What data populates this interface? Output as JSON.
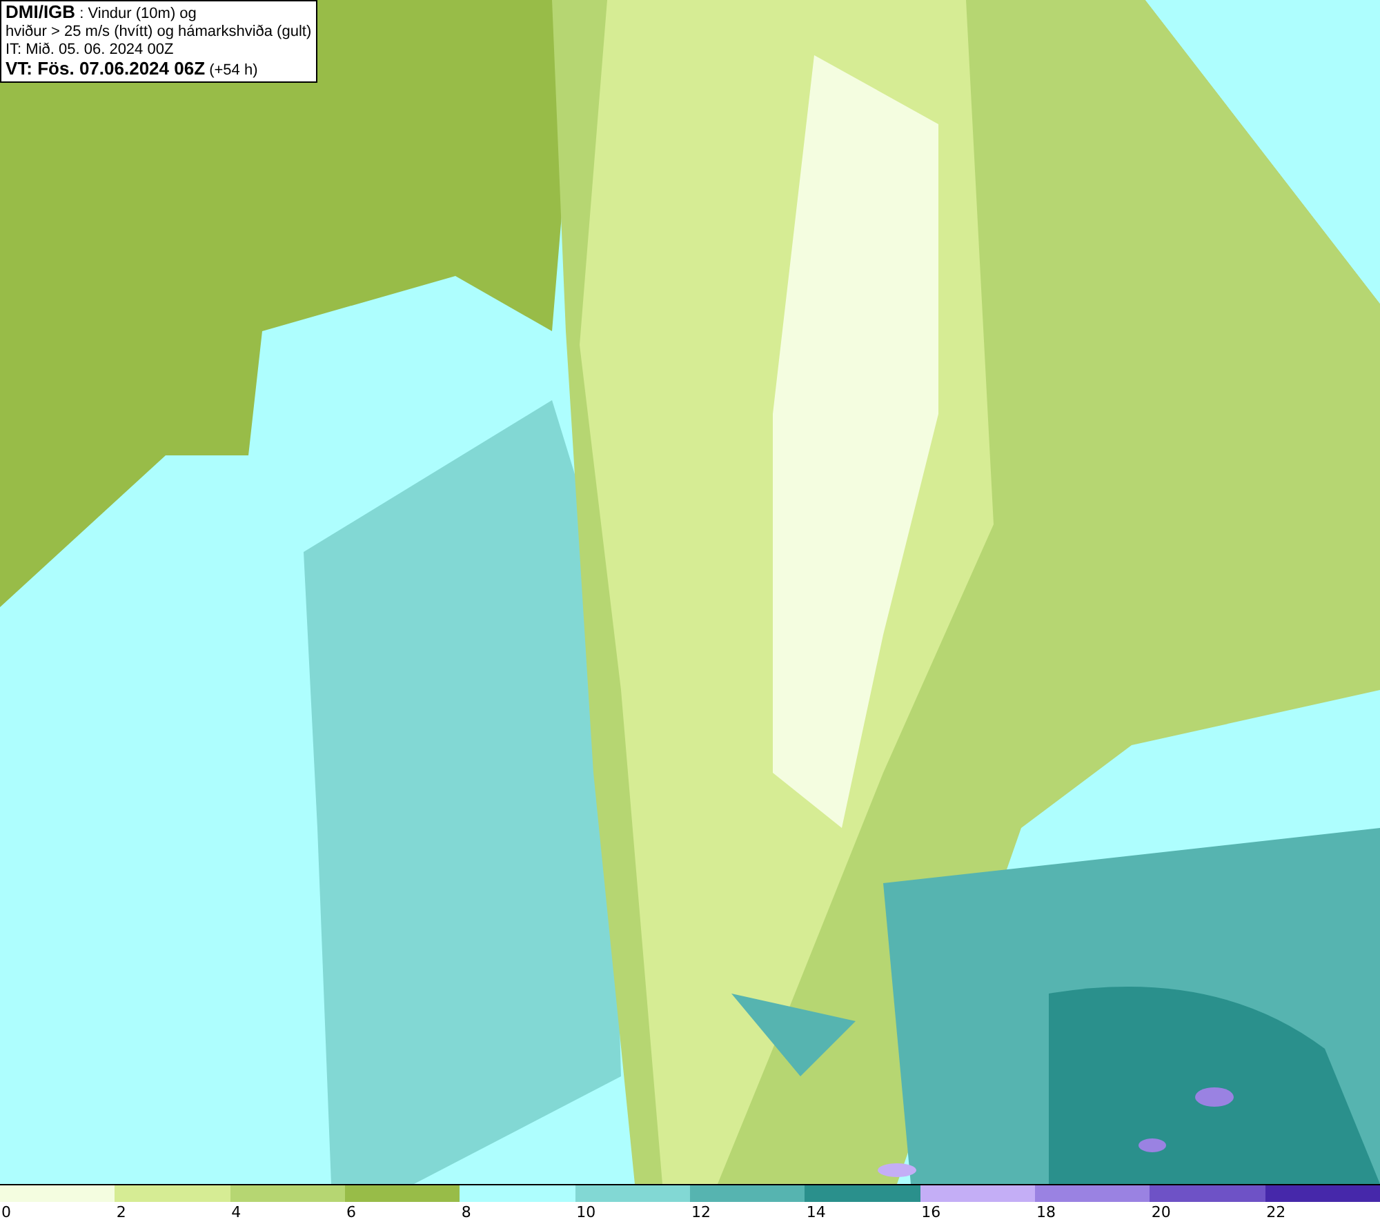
{
  "header": [
    "**DMI/IGB** : Vindur (10m) og",
    "hviður > 25 m/s (hvítt) og hámarkshviða (gult)",
    "IT: Mið. 05. 06. 2024 00Z",
    "**VT: Fös. 07.06.2024 06Z** (+54 h)"
  ],
  "legend": [
    {
      "label": "0",
      "color": "#f4fde0"
    },
    {
      "label": "2",
      "color": "#d6ec94"
    },
    {
      "label": "4",
      "color": "#b6d672"
    },
    {
      "label": "6",
      "color": "#98bc48"
    },
    {
      "label": "8",
      "color": "#aefefe"
    },
    {
      "label": "10",
      "color": "#82d8d4"
    },
    {
      "label": "12",
      "color": "#56b4b0"
    },
    {
      "label": "14",
      "color": "#2a908c"
    },
    {
      "label": "16",
      "color": "#c4aef6"
    },
    {
      "label": "18",
      "color": "#9a82e2"
    },
    {
      "label": "20",
      "color": "#6e52c6"
    },
    {
      "label": "22",
      "color": "#4628aa"
    }
  ]
}
